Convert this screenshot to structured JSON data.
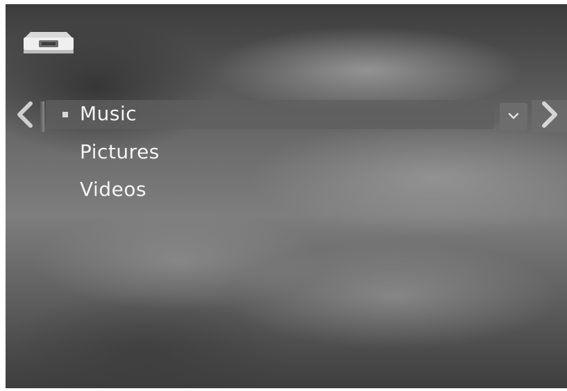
{
  "header": {
    "device_icon": "media-player-icon"
  },
  "navigation": {
    "prev_icon": "chevron-left-icon",
    "next_icon": "chevron-right-icon",
    "options_icon": "chevron-down-icon"
  },
  "menu": {
    "selected_index": 0,
    "items": [
      {
        "label": "Music"
      },
      {
        "label": "Pictures"
      },
      {
        "label": "Videos"
      }
    ]
  },
  "colors": {
    "text": "#f4f4f4",
    "highlight": "#5f5f5f",
    "background_dark": "#3c3c3c",
    "background_light": "#9a9a9a"
  }
}
